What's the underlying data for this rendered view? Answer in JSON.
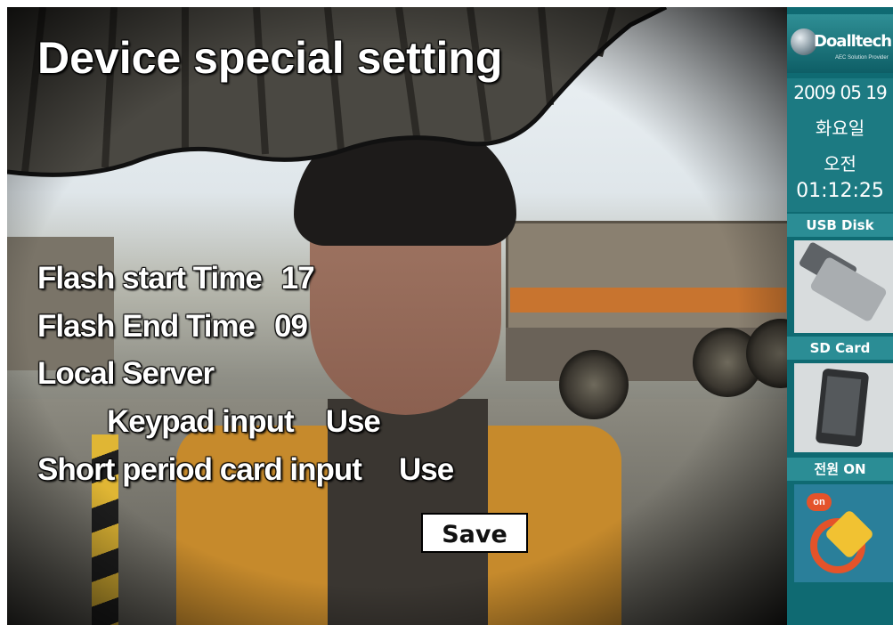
{
  "overlay": {
    "title": "Device special setting",
    "flash_start_label": "Flash start Time",
    "flash_start_value": "17",
    "flash_end_label": "Flash End Time",
    "flash_end_value": "09",
    "local_server_label": "Local Server",
    "keypad_label": "Keypad input",
    "keypad_value": "Use",
    "short_card_label": "Short period card input",
    "short_card_value": "Use",
    "save_label": "Save"
  },
  "side_panel": {
    "logo_text": "Doalltech",
    "logo_tagline": "AEC Solution Provider",
    "date": "2009 05 19",
    "weekday": "화요일",
    "ampm": "오전",
    "time": "01:12:25",
    "usb_label": "USB Disk",
    "sd_label": "SD Card",
    "power_label": "전원 ON",
    "power_badge": "on"
  },
  "colors": {
    "panel_bg": "#0f6a72",
    "panel_label_bg": "#2b8d95",
    "overlay_text": "#ffffff"
  },
  "icons": [
    "usb-disk-icon",
    "sd-card-icon",
    "power-plug-icon",
    "logo-globe-icon"
  ]
}
